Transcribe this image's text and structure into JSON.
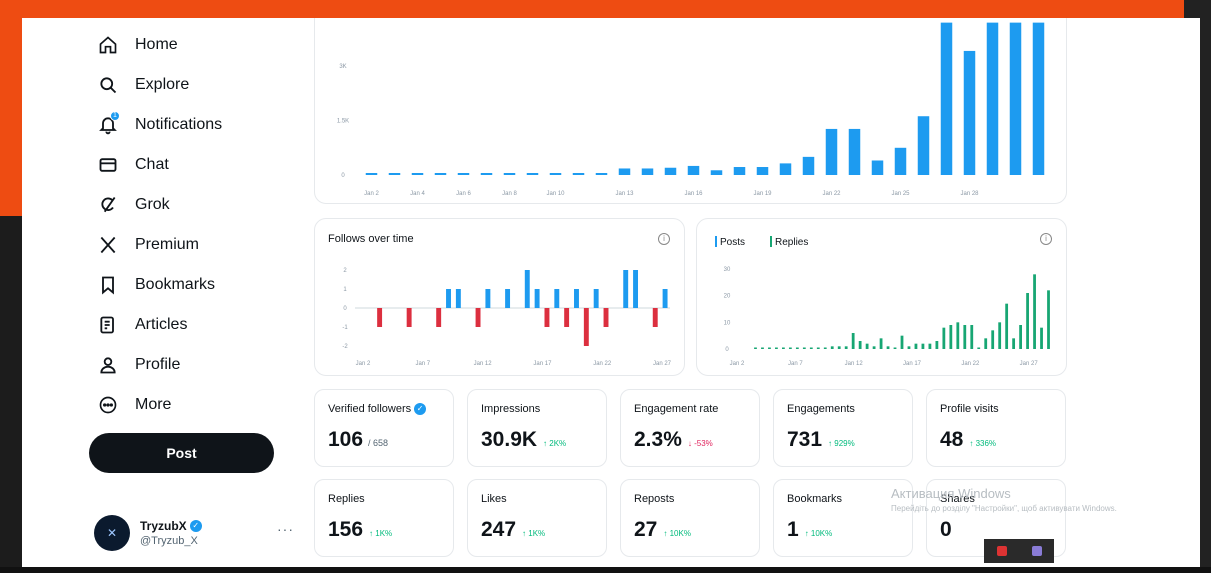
{
  "sidebar": {
    "items": [
      {
        "label": "Home",
        "icon": "home-icon"
      },
      {
        "label": "Explore",
        "icon": "search-icon"
      },
      {
        "label": "Notifications",
        "icon": "bell-icon"
      },
      {
        "label": "Chat",
        "icon": "mail-icon"
      },
      {
        "label": "Grok",
        "icon": "grok-icon"
      },
      {
        "label": "Premium",
        "icon": "x-logo-icon"
      },
      {
        "label": "Bookmarks",
        "icon": "bookmark-icon"
      },
      {
        "label": "Articles",
        "icon": "article-icon"
      },
      {
        "label": "Profile",
        "icon": "person-icon"
      },
      {
        "label": "More",
        "icon": "more-circle-icon"
      }
    ],
    "post_label": "Post",
    "account": {
      "name": "TryzubX",
      "handle": "@Tryzub_X",
      "more": "···"
    }
  },
  "chart_data": [
    {
      "type": "bar",
      "title": "",
      "y_ticks": [
        "0",
        "1.5K",
        "3K"
      ],
      "x_ticks": [
        "Jan 2",
        "Jan 4",
        "Jan 6",
        "Jan 8",
        "Jan 10",
        "Jan 13",
        "Jan 16",
        "Jan 19",
        "Jan 22",
        "Jan 25",
        "Jan 28"
      ],
      "values": [
        30,
        30,
        30,
        30,
        40,
        50,
        40,
        40,
        40,
        40,
        40,
        180,
        180,
        200,
        250,
        130,
        220,
        220,
        320,
        500,
        1270,
        1270,
        400,
        750,
        1620,
        4200,
        3420,
        4200,
        4200,
        4200
      ],
      "ylim": [
        0,
        4300
      ],
      "color": "#1d9bf0"
    },
    {
      "type": "bar",
      "title": "Follows over time",
      "y_ticks": [
        "2",
        "1",
        "0",
        "-1",
        "-2"
      ],
      "x_ticks": [
        "Jan 2",
        "Jan 7",
        "Jan 12",
        "Jan 17",
        "Jan 22",
        "Jan 27"
      ],
      "values": [
        0,
        0,
        -1,
        0,
        0,
        -1,
        0,
        0,
        -1,
        1,
        1,
        0,
        -1,
        1,
        0,
        1,
        0,
        2,
        1,
        -1,
        1,
        -1,
        1,
        -2,
        1,
        -1,
        0,
        2,
        2,
        0,
        -1,
        1
      ],
      "ylim": [
        -2.5,
        2.5
      ],
      "colors": {
        "positive": "#1d9bf0",
        "negative": "#dc2f3f"
      }
    },
    {
      "type": "bar",
      "title": "",
      "series": [
        {
          "name": "Posts",
          "color": "#1d9bf0"
        },
        {
          "name": "Replies",
          "color": "#17a673"
        }
      ],
      "y_ticks": [
        "30",
        "20",
        "10",
        "0"
      ],
      "x_ticks": [
        "Jan 2",
        "Jan 7",
        "Jan 12",
        "Jan 17",
        "Jan 22",
        "Jan 27"
      ],
      "values": [
        0,
        0,
        0,
        0,
        0,
        0,
        0,
        0,
        0,
        0,
        0,
        1,
        1,
        1,
        6,
        3,
        2,
        1,
        4,
        1,
        0,
        5,
        1,
        2,
        2,
        2,
        3,
        8,
        9,
        10,
        9,
        9,
        0,
        4,
        7,
        10,
        17,
        4,
        9,
        21,
        28,
        8,
        22
      ],
      "ylim": [
        0,
        32
      ]
    }
  ],
  "stats_row1": [
    {
      "label": "Verified followers",
      "value": "106",
      "sub": "/ 658",
      "verified": true
    },
    {
      "label": "Impressions",
      "value": "30.9K",
      "change": "↑ 2K%",
      "dir": "up"
    },
    {
      "label": "Engagement rate",
      "value": "2.3%",
      "change": "↓ -53%",
      "dir": "down"
    },
    {
      "label": "Engagements",
      "value": "731",
      "change": "↑ 929%",
      "dir": "up"
    },
    {
      "label": "Profile visits",
      "value": "48",
      "change": "↑ 336%",
      "dir": "up"
    }
  ],
  "stats_row2": [
    {
      "label": "Replies",
      "value": "156",
      "change": "↑ 1K%",
      "dir": "up"
    },
    {
      "label": "Likes",
      "value": "247",
      "change": "↑ 1K%",
      "dir": "up"
    },
    {
      "label": "Reposts",
      "value": "27",
      "change": "↑ 10K%",
      "dir": "up"
    },
    {
      "label": "Bookmarks",
      "value": "1",
      "change": "↑ 10K%",
      "dir": "up"
    },
    {
      "label": "Shares",
      "value": "0",
      "change": "",
      "dir": "up"
    }
  ],
  "windows_activation": {
    "title": "Активация Windows",
    "subtitle": "Перейдіть до розділу \"Настройки\", щоб активувати Windows."
  },
  "info_icon": "i",
  "verified_mark": "✓"
}
